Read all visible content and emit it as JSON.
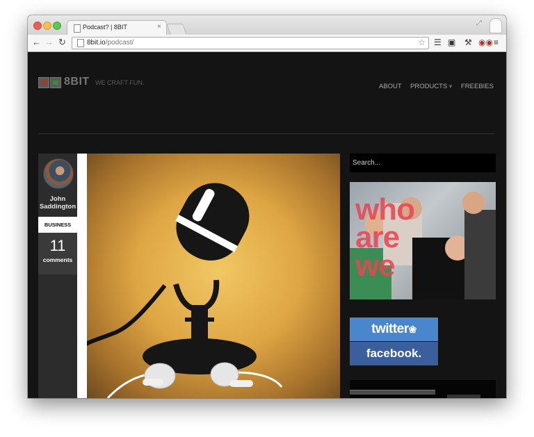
{
  "browser": {
    "tab_title": "Podcast? | 8BIT",
    "tab_close": "×",
    "url_host": "8bit.io",
    "url_path": "/podcast/"
  },
  "site": {
    "logo": "8BIT",
    "tagline": "WE CRAFT FUN.",
    "nav": {
      "about": "ABOUT",
      "products": "PRODUCTS",
      "freebies": "FREEBIES"
    }
  },
  "post": {
    "author_name": "John Saddington",
    "category": "BUSINESS",
    "comment_count": "11",
    "comment_label": "comments"
  },
  "sidebar": {
    "search_placeholder": "Search...",
    "promo_text": "who are we",
    "twitter_label": "twitter",
    "facebook_label": "facebook."
  },
  "icons": {
    "back": "back-arrow-icon",
    "forward": "forward-arrow-icon",
    "reload": "reload-icon",
    "bookmark": "star-icon",
    "menu": "menu-icon"
  },
  "colors": {
    "page_bg": "#141414",
    "twitter": "#4a86cc",
    "facebook": "#3a5f9c",
    "promo_text": "#e84652"
  }
}
